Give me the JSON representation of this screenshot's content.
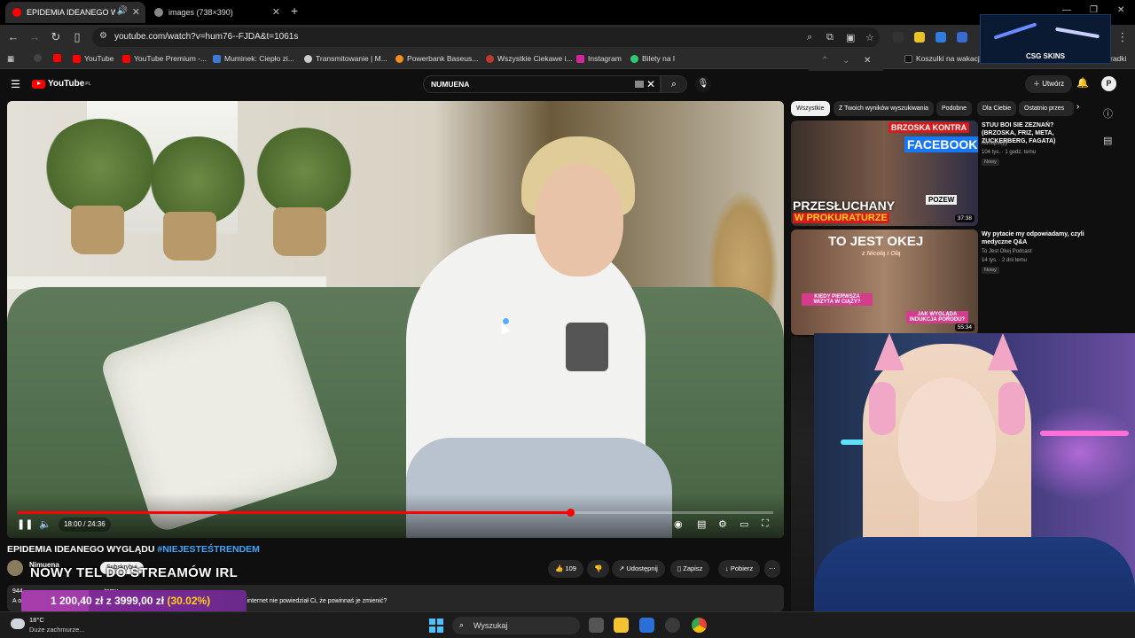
{
  "browser": {
    "tabs": [
      {
        "title": "EPIDEMIA IDEANEGO WYGLĄDU",
        "active": true
      },
      {
        "title": "images (738×390)",
        "active": false
      }
    ],
    "url": "youtube.com/watch?v=hum76--FJDA&t=1061s",
    "bookmarks": [
      "YouTube",
      "YouTube Premium -...",
      "Muminek: Ciepło zi...",
      "Transmitowanie | M...",
      "Powerbank Baseus...",
      "Wszystkie Ciekawe i...",
      "Instagram",
      "Bilety na l",
      "Koszulki na wakacje...",
      "radki"
    ],
    "csg_logo": "CSG SKINS"
  },
  "youtube": {
    "logo": "YouTube",
    "logo_region": "PL",
    "search_query": "NUMUENA",
    "create_label": "Utwórz",
    "avatar_letter": "P"
  },
  "player": {
    "time": "18:00 / 24:36",
    "progress_fraction": 0.7317
  },
  "video": {
    "title_main": "EPIDEMIA IDEANEGO WYGLĄDU",
    "title_tag": "#NIEJESTEŚTRENDEM",
    "channel": "Nimuena",
    "subscribe_label": "Subskrybuj",
    "overlay_text": "NOWY TEL DO STREAMÓW IRL",
    "likes": "109",
    "share_label": "Udostępnij",
    "save_label": "Zapisz",
    "download_label": "Pobierz",
    "desc_views": "944",
    "desc_ago": "temu",
    "desc_line2_start": "A o",
    "desc_line2": "gdyby internet nie powiedział Ci, że powinnaś je zmienić?"
  },
  "donation": {
    "amount": "1 200,40 zł",
    "goal": "z 3999,00 zł",
    "percent": "(30.02%)",
    "progress_fraction": 0.3002
  },
  "sidebar": {
    "chips": [
      "Wszystkie",
      "Z Twoich wyników wyszukiwania",
      "Podobne",
      "Dla Ciebie",
      "Ostatnio przes"
    ],
    "recommendations": [
      {
        "title": "STUU BOI SIE ZEZNAŃ? (BRZOSKA, FRIZ, META, ZUCKERBERG, FAGATA)",
        "channel": "Konopskyy",
        "meta": "104 tys. · 1 godz. temu",
        "badge": "Nowy",
        "duration": "37:38",
        "thumb_text_top": "BRZOSKA KONTRA",
        "thumb_text_brand": "FACEBOOK",
        "thumb_text_bottom1": "PRZESŁUCHANY",
        "thumb_text_bottom2": "W PROKURATURZE",
        "thumb_tag": "POZEW"
      },
      {
        "title": "Wy pytacie my odpowiadamy, czyli medyczne Q&A",
        "channel": "To Jest Okej Podcast",
        "meta": "14 tys. · 2 dni temu",
        "badge": "Nowy",
        "duration": "55:34",
        "thumb_text_top": "TO JEST OKEJ",
        "thumb_text_sub": "z Nicolą i Olą",
        "thumb_bubble1": "KIEDY PIERWSZA WIZYTA W CIĄŻY?",
        "thumb_bubble2": "JAK WYGLĄDA INDUKCJA PORODU?"
      }
    ]
  },
  "taskbar": {
    "temp": "18°C",
    "weather": "Duże zachmurze...",
    "search_placeholder": "Wyszukaj"
  },
  "colors": {
    "accent_red": "#ff0000",
    "link_blue": "#3ea6ff",
    "donation_purple": "#8a2a9c",
    "donation_yellow": "#ffd21a"
  }
}
